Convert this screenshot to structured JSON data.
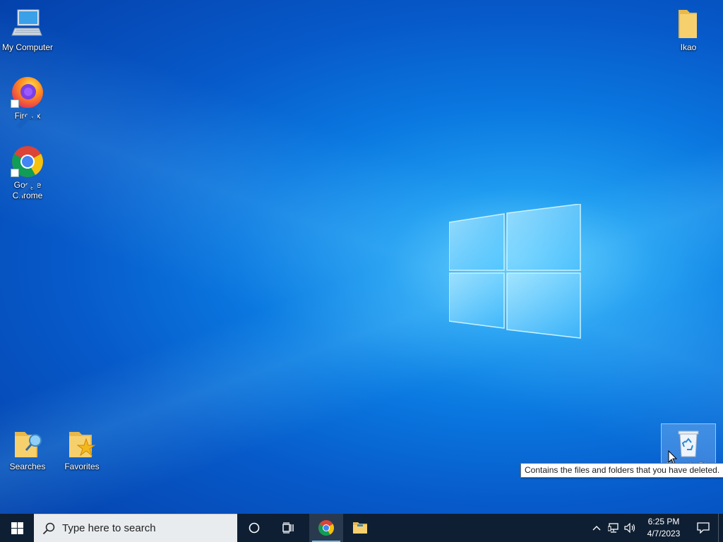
{
  "desktop": {
    "icons_left": [
      {
        "label": "My Computer",
        "icon": "computer-icon"
      },
      {
        "label": "Firefox",
        "icon": "firefox-icon"
      },
      {
        "label": "Google Chrome",
        "icon": "chrome-icon"
      }
    ],
    "icons_bottom": [
      {
        "label": "Searches",
        "icon": "searches-folder-icon"
      },
      {
        "label": "Favorites",
        "icon": "favorites-folder-icon"
      }
    ],
    "icon_right_top": {
      "label": "Ikao",
      "icon": "folder-icon"
    },
    "recycle_bin": {
      "label": "Recycle Bin",
      "icon": "recycle-bin-icon"
    },
    "tooltip": "Contains the files and folders that you have deleted."
  },
  "taskbar": {
    "search_placeholder": "Type here to search",
    "clock_time": "6:25 PM",
    "clock_date": "4/7/2023",
    "accent": "#76b9ed"
  }
}
